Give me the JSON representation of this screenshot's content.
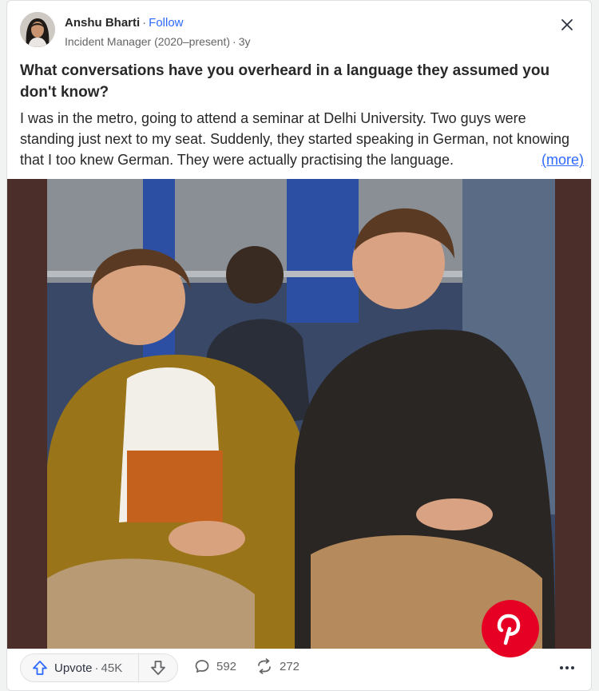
{
  "author": {
    "name": "Anshu Bharti",
    "separator": "·",
    "follow_label": "Follow",
    "credential": "Incident Manager (2020–present)",
    "age": "3y"
  },
  "question": {
    "title": "What conversations have you overheard in a language they assumed you don't know?"
  },
  "answer": {
    "preview": "I was in the metro, going to attend a seminar at Delhi University. Two guys were standing just next to my seat. Suddenly, they started speaking in German, not knowing that I too knew German. They were actually practising the language.",
    "more_label": "(more)"
  },
  "media": {
    "pinterest_icon": "pinterest-icon"
  },
  "actions": {
    "upvote_label": "Upvote",
    "upvote_count": "45K",
    "comment_count": "592",
    "share_count": "272"
  },
  "colors": {
    "accent": "#2e69ff",
    "pinterest": "#e60023",
    "frame": "#4b2d29"
  }
}
